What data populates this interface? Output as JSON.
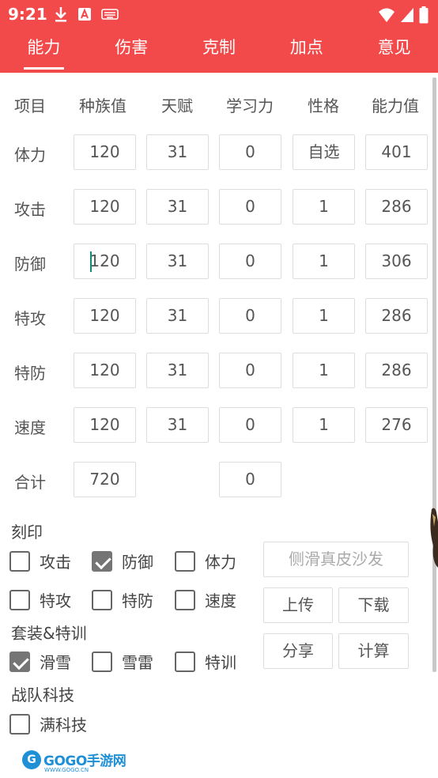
{
  "status_bar": {
    "time": "9:21"
  },
  "tabs": [
    "能力",
    "伤害",
    "克制",
    "加点",
    "意见"
  ],
  "table": {
    "headers": [
      "项目",
      "种族值",
      "天赋",
      "学习力",
      "性格",
      "能力值"
    ],
    "rows": [
      {
        "label": "体力",
        "race": "120",
        "talent": "31",
        "learn": "0",
        "nature": "自选",
        "ability": "401"
      },
      {
        "label": "攻击",
        "race": "120",
        "talent": "31",
        "learn": "0",
        "nature": "1",
        "ability": "286"
      },
      {
        "label": "防御",
        "race": "120",
        "talent": "31",
        "learn": "0",
        "nature": "1",
        "ability": "306"
      },
      {
        "label": "特攻",
        "race": "120",
        "talent": "31",
        "learn": "0",
        "nature": "1",
        "ability": "286"
      },
      {
        "label": "特防",
        "race": "120",
        "talent": "31",
        "learn": "0",
        "nature": "1",
        "ability": "286"
      },
      {
        "label": "速度",
        "race": "120",
        "talent": "31",
        "learn": "0",
        "nature": "1",
        "ability": "276"
      }
    ],
    "total": {
      "label": "合计",
      "race": "720",
      "learn": "0"
    }
  },
  "imprint": {
    "title": "刻印",
    "items": [
      {
        "label": "攻击",
        "checked": false
      },
      {
        "label": "防御",
        "checked": true
      },
      {
        "label": "体力",
        "checked": false
      },
      {
        "label": "特攻",
        "checked": false
      },
      {
        "label": "特防",
        "checked": false
      },
      {
        "label": "速度",
        "checked": false
      }
    ]
  },
  "suit": {
    "title": "套装&特训",
    "items": [
      {
        "label": "滑雪",
        "checked": true
      },
      {
        "label": "雪雷",
        "checked": false
      },
      {
        "label": "特训",
        "checked": false
      }
    ]
  },
  "team": {
    "title": "战队科技",
    "items": [
      {
        "label": "满科技",
        "checked": false
      }
    ]
  },
  "buttons": {
    "sofa": "侧滑真皮沙发",
    "upload": "上传",
    "download": "下载",
    "share": "分享",
    "calculate": "计算"
  },
  "watermark": {
    "brand": "GOGO手游网",
    "site": "WWW.GOGO.CN"
  }
}
